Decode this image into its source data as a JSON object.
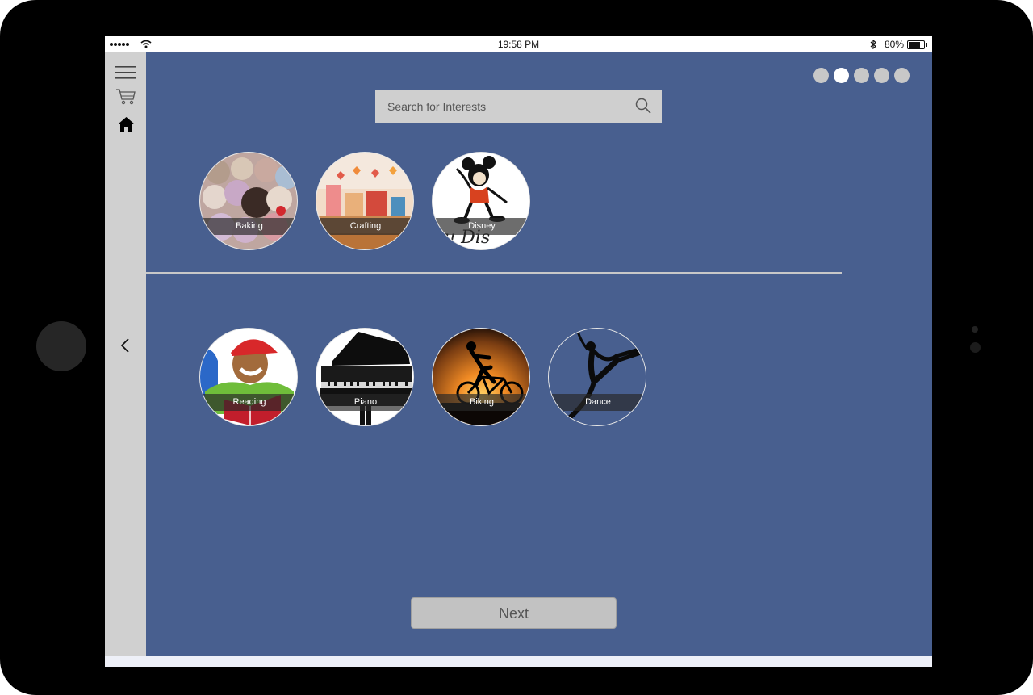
{
  "status_bar": {
    "time": "19:58 PM",
    "battery": "80%",
    "battery_level": 0.8
  },
  "sidebar": {
    "icons": [
      "menu-icon",
      "cart-icon",
      "home-icon"
    ]
  },
  "progress": {
    "total_steps": 5,
    "current_step": 2
  },
  "search": {
    "placeholder": "Search for Interests"
  },
  "selected_interests": [
    {
      "label": "Baking"
    },
    {
      "label": "Crafting"
    },
    {
      "label": "Disney"
    }
  ],
  "suggested_interests": [
    {
      "label": "Reading"
    },
    {
      "label": "Piano"
    },
    {
      "label": "Biking"
    },
    {
      "label": "Dance"
    }
  ],
  "navigation": {
    "back_icon": "chevron-left-icon",
    "next_label": "Next"
  },
  "colors": {
    "background": "#485f8f",
    "sidebar": "#d0d0d0",
    "button": "#c2c2c2"
  }
}
